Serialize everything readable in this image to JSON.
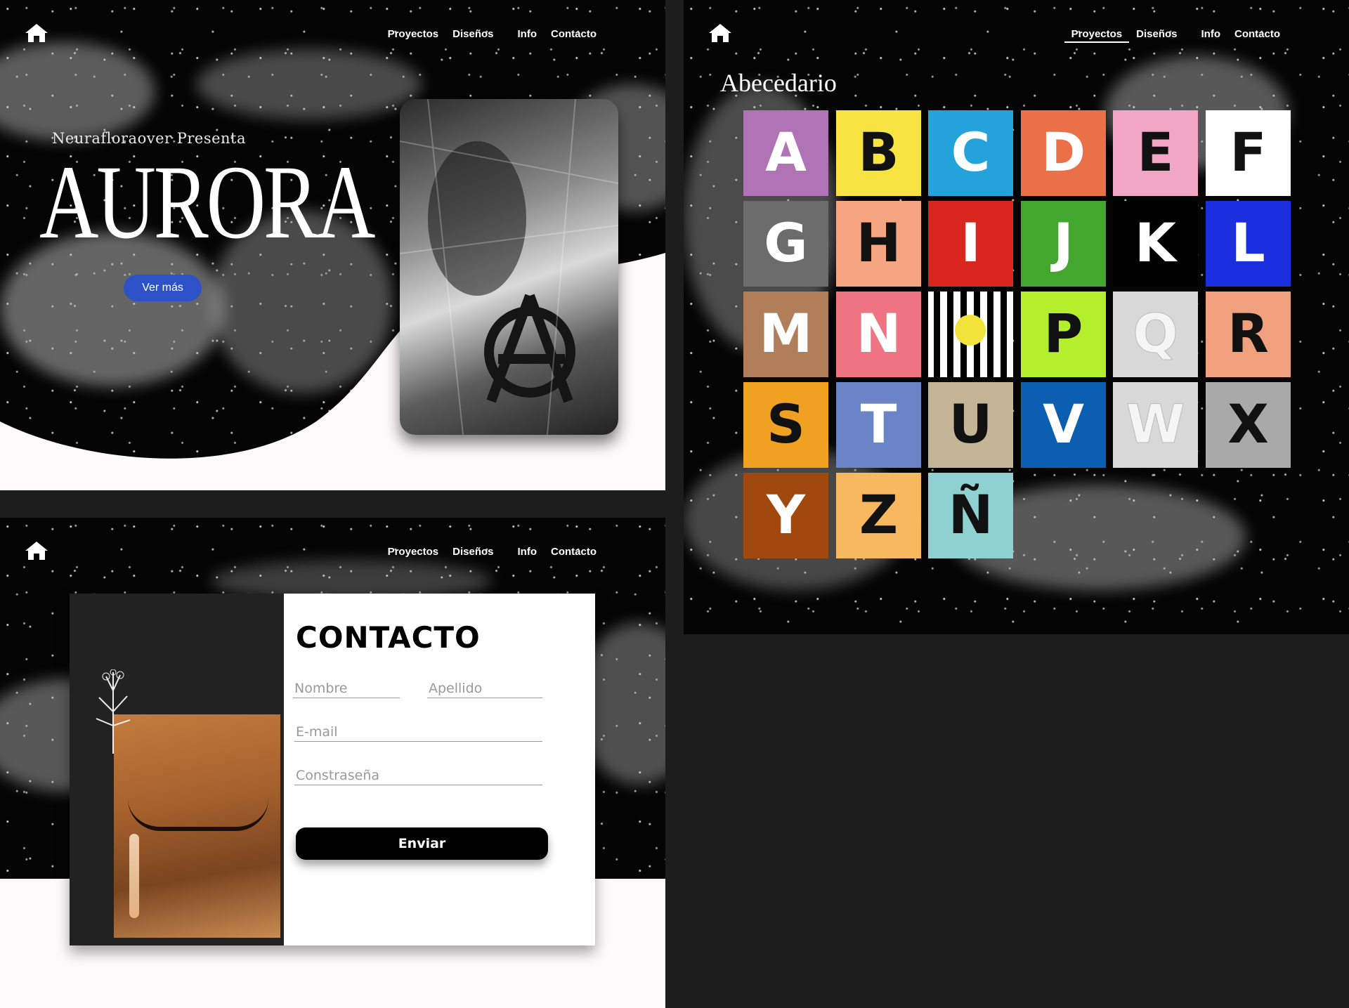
{
  "nav": {
    "links": [
      "Proyectos",
      "Diseños",
      "Info",
      "Contacto"
    ]
  },
  "hero": {
    "presenta": "Neurafloraover Presenta",
    "title": "AURORA",
    "cta_label": "Ver más"
  },
  "contact": {
    "title": "CONTACTO",
    "fields": {
      "nombre": "Nombre",
      "apellido": "Apellido",
      "email": "E-mail",
      "password": "Constraseña"
    },
    "submit_label": "Enviar"
  },
  "projects": {
    "heading": "Abecedario",
    "active_nav": "Proyectos",
    "tiles": [
      {
        "letter": "A",
        "bg": "#b073b5"
      },
      {
        "letter": "B",
        "bg": "#f7e442"
      },
      {
        "letter": "C",
        "bg": "#23a2dc"
      },
      {
        "letter": "D",
        "bg": "#ea7048"
      },
      {
        "letter": "E",
        "bg": "#f1a6c6"
      },
      {
        "letter": "F",
        "bg": "#ffffff"
      },
      {
        "letter": "G",
        "bg": "#6c6c6c"
      },
      {
        "letter": "H",
        "bg": "#f5a581"
      },
      {
        "letter": "I",
        "bg": "#d9271f"
      },
      {
        "letter": "J",
        "bg": "#43a62e"
      },
      {
        "letter": "K",
        "bg": "#000000"
      },
      {
        "letter": "L",
        "bg": "#1c2fdf"
      },
      {
        "letter": "M",
        "bg": "#b07e58"
      },
      {
        "letter": "N",
        "bg": "#ee7481"
      },
      {
        "letter": "O",
        "bg": "#ffffff"
      },
      {
        "letter": "P",
        "bg": "#b4ef2d"
      },
      {
        "letter": "Q",
        "bg": "#d8d8d8"
      },
      {
        "letter": "R",
        "bg": "#f0a07d"
      },
      {
        "letter": "S",
        "bg": "#f0a121"
      },
      {
        "letter": "T",
        "bg": "#6a84c6"
      },
      {
        "letter": "U",
        "bg": "#c5b597"
      },
      {
        "letter": "V",
        "bg": "#0c5fb0"
      },
      {
        "letter": "W",
        "bg": "#d8d8d8"
      },
      {
        "letter": "X",
        "bg": "#a9a9a9"
      },
      {
        "letter": "Y",
        "bg": "#a0480d"
      },
      {
        "letter": "Z",
        "bg": "#f7b85f"
      },
      {
        "letter": "Ñ",
        "bg": "#8fd1d1"
      }
    ]
  }
}
